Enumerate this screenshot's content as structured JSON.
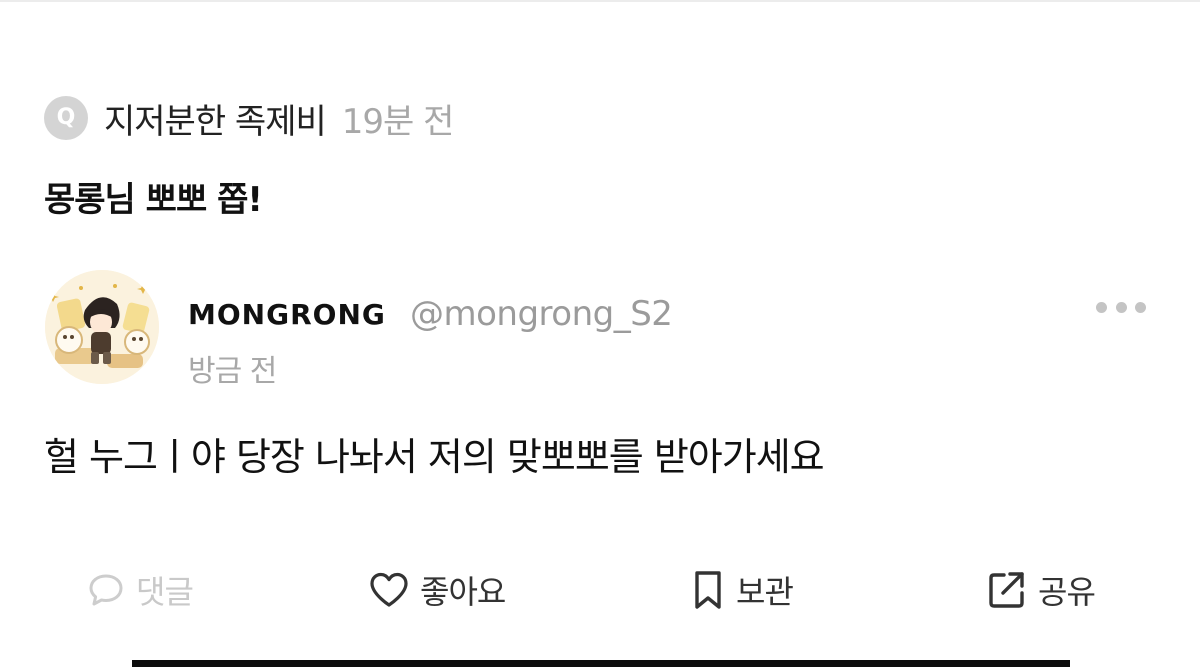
{
  "question": {
    "badge": "Q",
    "asker": "지저분한 족제비",
    "time": "19분 전",
    "text": "몽롱님 뽀뽀 쫍!"
  },
  "answer": {
    "author_name": "MONGRONG",
    "author_handle": "@mongrong_S2",
    "time": "방금 전",
    "text": "헐 누그ㅣ야 당장 나놔서 저의 맞뽀뽀를 받아가세요"
  },
  "actions": {
    "comment": "댓글",
    "like": "좋아요",
    "save": "보관",
    "share": "공유"
  },
  "colors": {
    "muted": "#a8a8a8",
    "disabled": "#c9c9c9",
    "icon": "#333333"
  },
  "icons": {
    "badge": "q-badge-icon",
    "more": "more-dots-icon",
    "comment": "speech-bubble-icon",
    "like": "heart-icon",
    "save": "bookmark-icon",
    "share": "share-arrow-icon"
  }
}
